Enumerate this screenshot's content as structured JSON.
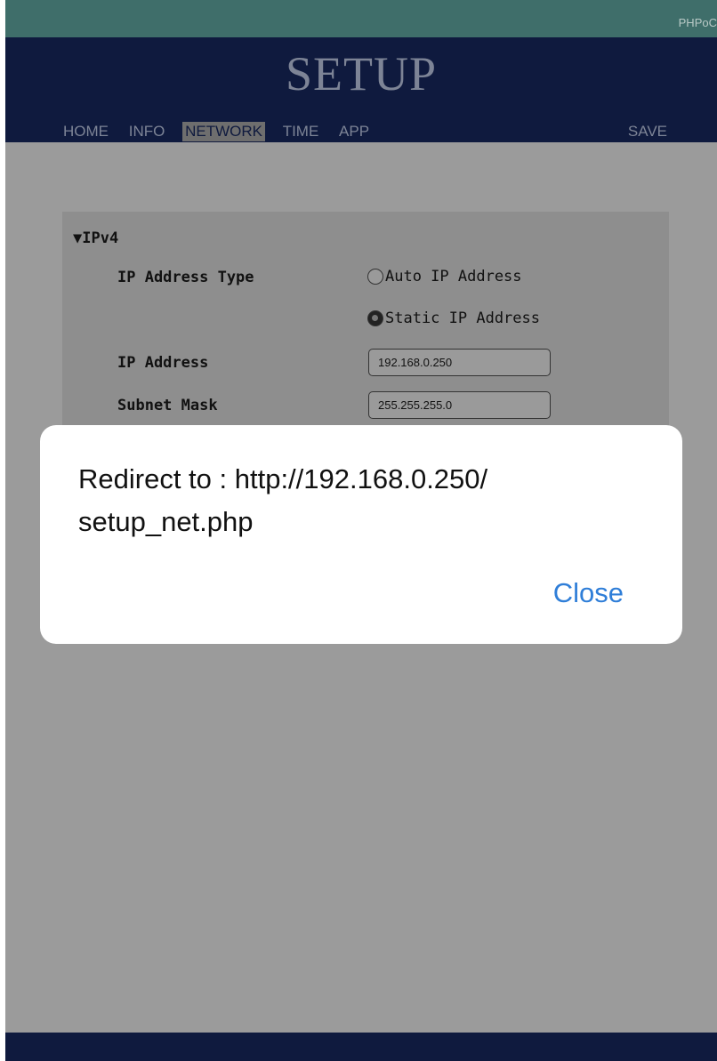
{
  "brand": "PHPoC",
  "header": {
    "title": "SETUP",
    "nav": [
      "HOME",
      "INFO",
      "NETWORK",
      "TIME",
      "APP"
    ],
    "active_tab": "NETWORK",
    "save_label": "SAVE"
  },
  "ipv4": {
    "section_label": "▼IPv4",
    "ip_type_label": "IP Address Type",
    "options": [
      "Auto IP Address",
      "Static IP Address"
    ],
    "selected_option": "Static IP Address",
    "ip_label": "IP Address",
    "ip_value": "192.168.0.250",
    "subnet_label": "Subnet Mask",
    "subnet_value": "255.255.255.0"
  },
  "dialog": {
    "message": "Redirect to : http://192.168.0.250/\nsetup_net.php",
    "close_label": "Close"
  },
  "colors": {
    "header": "#0f1a3e",
    "topbar": "#3f6e6a",
    "page_bg": "#9b9b9b",
    "link_blue": "#2f7ed8"
  }
}
